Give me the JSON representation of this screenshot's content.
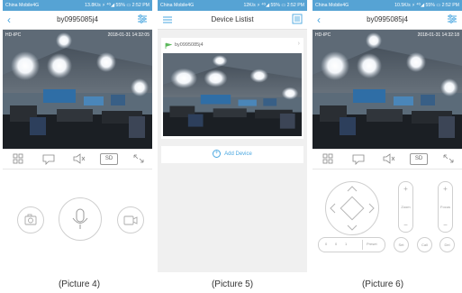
{
  "status": {
    "p4": {
      "carrier": "China Mobile4G",
      "right": "13.8K/s ⚡ ⁴ᴳ◢ 55% ▭ 2:52 PM"
    },
    "p5": {
      "carrier": "China Mobile4G",
      "right": "12K/s ⚡ ⁴ᴳ◢ 55% ▭ 2:52 PM"
    },
    "p6": {
      "carrier": "China Mobile4G",
      "right": "10.5K/s ⚡ ⁴ᴳ◢ 55% ▭ 2:52 PM"
    }
  },
  "p4": {
    "title": "by0995085j4",
    "hd": "HD-IPC",
    "timestamp": "2018-01-31 14:32:05",
    "sd": "SD"
  },
  "p5": {
    "title": "Device Listist",
    "device_name": "by0995085j4",
    "add_device": "Add Device"
  },
  "p6": {
    "title": "by0995085j4",
    "hd": "HD-IPC",
    "timestamp": "2018-01-31 14:32:18",
    "sd": "SD",
    "zoom": "Zoom",
    "focus": "Focus",
    "preset_nums": [
      "0",
      "0",
      "1"
    ],
    "preset": "Preset",
    "btn_set": "Set",
    "btn_call": "Call",
    "btn_del": "Del"
  },
  "captions": [
    "(Picture 4)",
    "(Picture 5)",
    "(Picture 6)"
  ],
  "colors": {
    "accent": "#4aa7e0",
    "status_bar": "#56a3d4",
    "app_bg": "#f0f0f0"
  }
}
